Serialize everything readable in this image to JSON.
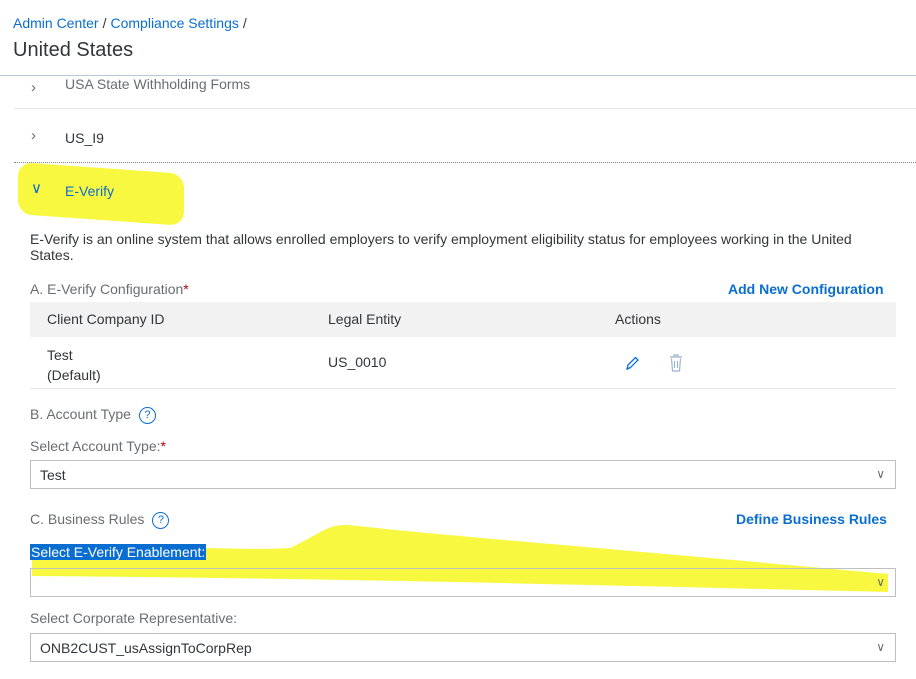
{
  "breadcrumb": {
    "item1": "Admin Center",
    "item2": "Compliance Settings",
    "sep": "/"
  },
  "page_title": "United States",
  "sections": {
    "usa_state": "USA State Withholding Forms",
    "us_i9": "US_I9",
    "everify": "E-Verify"
  },
  "everify": {
    "description": "E-Verify is an online system that allows enrolled employers to verify employment eligibility status for employees working in the United States.",
    "config_label": "A. E-Verify Configuration",
    "add_config_link": "Add New Configuration",
    "table": {
      "headers": [
        "Client Company ID",
        "Legal Entity",
        "Actions"
      ],
      "rows": [
        {
          "client_company_id": "Test",
          "default_note": "(Default)",
          "legal_entity": "US_0010"
        }
      ]
    },
    "account_type_label": "B. Account Type",
    "select_account_type_label": "Select Account Type:",
    "account_type_value": "Test",
    "business_rules_label": "C. Business Rules",
    "define_rules_link": "Define Business Rules",
    "select_enablement_label": "Select E-Verify Enablement:",
    "enablement_value": "",
    "select_corp_rep_label": "Select Corporate Representative:",
    "corp_rep_value": "ONB2CUST_usAssignToCorpRep",
    "required_mark": "*",
    "help_glyph": "?"
  },
  "colors": {
    "accent": "#0a6ed1",
    "highlight": "#f7f72b",
    "required": "#bb0000"
  },
  "icons": [
    "chevron-right-icon",
    "chevron-down-icon",
    "pencil-icon",
    "trash-icon",
    "help-icon",
    "dropdown-arrow-icon"
  ]
}
